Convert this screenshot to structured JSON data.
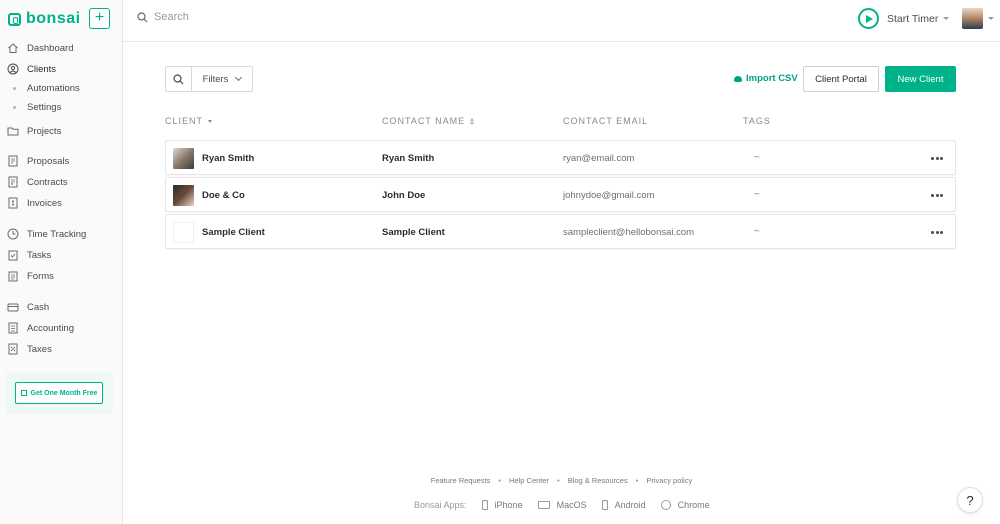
{
  "brand": {
    "name": "bonsai",
    "accent": "#00b289"
  },
  "sidebar": {
    "add_label": "+",
    "items": [
      {
        "label": "Dashboard",
        "icon": "home-icon"
      },
      {
        "label": "Clients",
        "icon": "clients-icon",
        "active": true
      },
      {
        "label": "Projects",
        "icon": "folder-icon"
      },
      {
        "label": "Proposals",
        "icon": "proposal-icon"
      },
      {
        "label": "Contracts",
        "icon": "contract-icon"
      },
      {
        "label": "Invoices",
        "icon": "invoice-icon"
      },
      {
        "label": "Time Tracking",
        "icon": "clock-icon"
      },
      {
        "label": "Tasks",
        "icon": "tasks-icon"
      },
      {
        "label": "Forms",
        "icon": "forms-icon"
      },
      {
        "label": "Cash",
        "icon": "cash-icon"
      },
      {
        "label": "Accounting",
        "icon": "accounting-icon"
      },
      {
        "label": "Taxes",
        "icon": "taxes-icon"
      }
    ],
    "sub_items": [
      {
        "label": "Automations"
      },
      {
        "label": "Settings"
      }
    ],
    "promo_label": "Get One Month Free"
  },
  "topbar": {
    "search_placeholder": "Search",
    "timer_label": "Start Timer"
  },
  "toolbar": {
    "filters_label": "Filters",
    "import_label": "Import CSV",
    "portal_label": "Client Portal",
    "new_label": "New Client"
  },
  "table": {
    "headers": [
      "CLIENT",
      "CONTACT NAME",
      "CONTACT EMAIL",
      "TAGS"
    ],
    "rows": [
      {
        "client": "Ryan Smith",
        "contact": "Ryan Smith",
        "email": "ryan@email.com",
        "tags": "–"
      },
      {
        "client": "Doe & Co",
        "contact": "John Doe",
        "email": "johnydoe@gmail.com",
        "tags": "–"
      },
      {
        "client": "Sample Client",
        "contact": "Sample Client",
        "email": "sampleclient@hellobonsai.com",
        "tags": "–"
      }
    ]
  },
  "footer": {
    "links": [
      "Feature Requests",
      "Help Center",
      "Blog & Resources",
      "Privacy policy"
    ],
    "separator": "•",
    "apps_label": "Bonsai Apps:",
    "apps": [
      "iPhone",
      "MacOS",
      "Android",
      "Chrome"
    ],
    "help_label": "?"
  }
}
